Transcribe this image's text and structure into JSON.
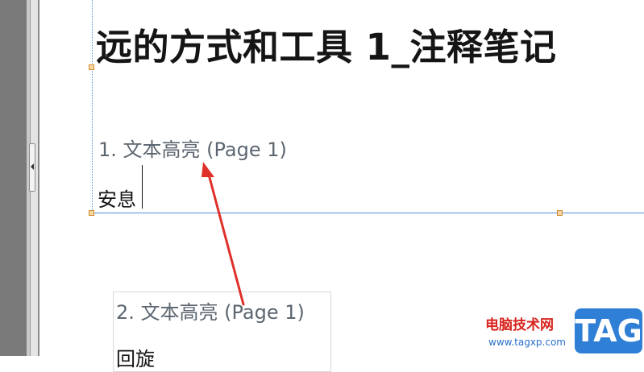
{
  "note": {
    "title": "远的方式和工具 1_注释笔记",
    "highlights": [
      {
        "label": "1. 文本高亮  (Page 1)",
        "text": "安息"
      },
      {
        "label": "2. 文本高亮  (Page 1)",
        "text": "回旋"
      }
    ]
  },
  "watermark": {
    "site_name": "电脑技术网",
    "url": "www.tagxp.com",
    "tag": "TAG"
  },
  "colors": {
    "annotation_arrow": "#e0302a",
    "selection_border": "#4a90d9",
    "watermark_badge": "#2f7fd6"
  },
  "icons": {
    "collapse_panel": "chevron-left-icon",
    "annotation": "red-arrow-pointer"
  }
}
